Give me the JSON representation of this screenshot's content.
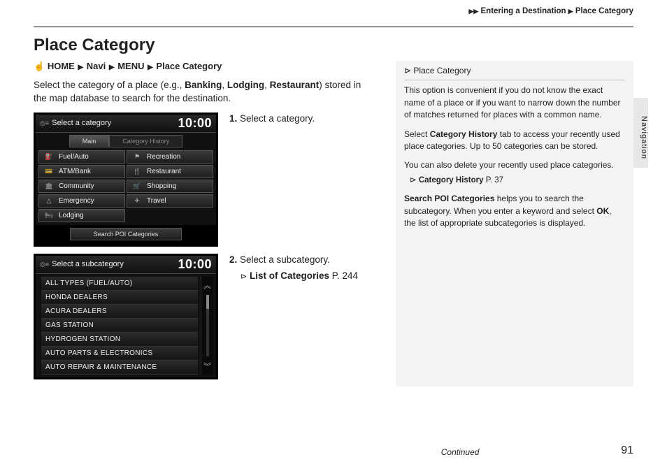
{
  "breadcrumb": {
    "a": "Entering a Destination",
    "b": "Place Category"
  },
  "title": "Place Category",
  "path": {
    "home": "HOME",
    "navi": "Navi",
    "menu": "MENU",
    "cat": "Place Category"
  },
  "intro": {
    "pre": "Select the category of a place (e.g., ",
    "b1": "Banking",
    "c1": ", ",
    "b2": "Lodging",
    "c2": ", ",
    "b3": "Restaurant",
    "post": ") stored in the map database to search for the destination."
  },
  "screen1": {
    "title": "Select a category",
    "clock": "10:00",
    "tab_main": "Main",
    "tab_hist": "Category History",
    "cells": {
      "c0": "Fuel/Auto",
      "c1": "Recreation",
      "c2": "ATM/Bank",
      "c3": "Restaurant",
      "c4": "Community",
      "c5": "Shopping",
      "c6": "Emergency",
      "c7": "Travel",
      "c8": "Lodging"
    },
    "search": "Search POI Categories"
  },
  "step1": {
    "n": "1.",
    "text": " Select a category."
  },
  "screen2": {
    "title": "Select a subcategory",
    "clock": "10:00",
    "items": {
      "i0": "ALL TYPES (FUEL/AUTO)",
      "i1": "HONDA DEALERS",
      "i2": "ACURA DEALERS",
      "i3": "GAS STATION",
      "i4": "HYDROGEN STATION",
      "i5": "AUTO PARTS & ELECTRONICS",
      "i6": "AUTO REPAIR & MAINTENANCE"
    }
  },
  "step2": {
    "n": "2.",
    "text": " Select a subcategory.",
    "ref_label": "List of Categories",
    "ref_page": " P. 244"
  },
  "sidebar": {
    "title": "Place Category",
    "p1": "This option is convenient if you do not know the exact name of a place or if you want to narrow down the number of matches returned for places with a common name.",
    "p2a": "Select ",
    "p2b": "Category History",
    "p2c": " tab to access your recently used place categories. Up to 50 categories can be stored.",
    "p3": "You can also delete your recently used place categories.",
    "ref_label": "Category History",
    "ref_page": " P. 37",
    "p4a": "Search POI Categories",
    "p4b": " helps you to search the subcategory. When you enter a keyword and select ",
    "p4c": "OK",
    "p4d": ", the list of appropriate subcategories is displayed."
  },
  "sidetab": "Navigation",
  "footer": {
    "continued": "Continued",
    "page": "91"
  }
}
